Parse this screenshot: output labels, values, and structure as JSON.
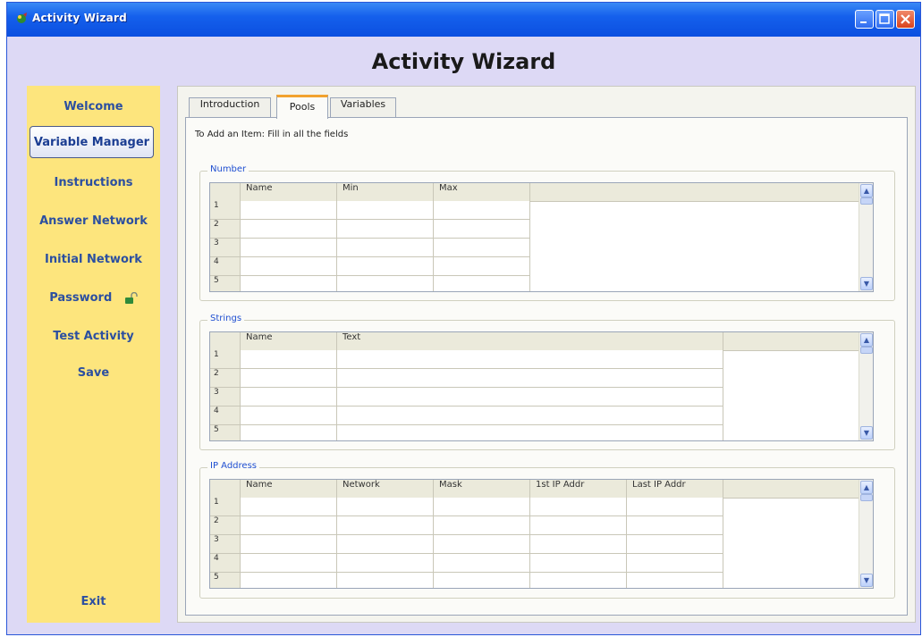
{
  "window": {
    "title": "Activity Wizard"
  },
  "heading": "Activity Wizard",
  "sidebar": {
    "items": [
      {
        "label": "Welcome"
      },
      {
        "label": "Variable Manager",
        "active": true
      },
      {
        "label": "Instructions"
      },
      {
        "label": "Answer Network"
      },
      {
        "label": "Initial Network"
      },
      {
        "label": "Password",
        "icon": "lock-icon"
      },
      {
        "label": "Test Activity"
      },
      {
        "label": "Save"
      }
    ],
    "exit": "Exit"
  },
  "tabs": [
    {
      "label": "Introduction"
    },
    {
      "label": "Pools",
      "active": true
    },
    {
      "label": "Variables"
    }
  ],
  "hint": "To Add an Item: Fill in all the fields",
  "groups": [
    {
      "title": "Number",
      "columns": [
        "Name",
        "Min",
        "Max"
      ],
      "rows": [
        "1",
        "2",
        "3",
        "4",
        "5"
      ]
    },
    {
      "title": "Strings",
      "columns": [
        "Name",
        "Text"
      ],
      "rows": [
        "1",
        "2",
        "3",
        "4",
        "5"
      ]
    },
    {
      "title": "IP Address",
      "columns": [
        "Name",
        "Network",
        "Mask",
        "1st IP Addr",
        "Last IP Addr"
      ],
      "rows": [
        "1",
        "2",
        "3",
        "4",
        "5"
      ]
    }
  ],
  "colors": {
    "title_bar": "#1560ec",
    "sidebar": "#fde57d",
    "nav_text": "#2c4fa0",
    "background": "#ddd9f5",
    "active_tab": "#f2a22e"
  }
}
